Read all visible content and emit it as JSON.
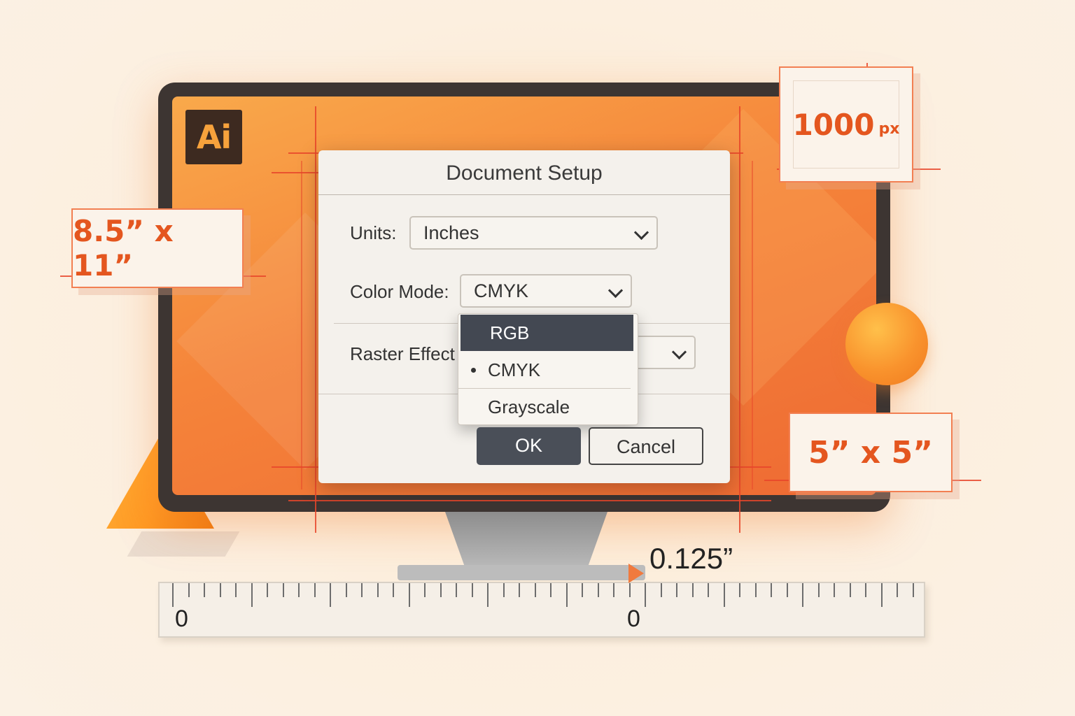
{
  "app": {
    "logo_text": "Ai"
  },
  "dialog": {
    "title": "Document Setup",
    "units_label": "Units:",
    "units_value": "Inches",
    "color_mode_label": "Color Mode:",
    "color_mode_value": "CMYK",
    "raster_label": "Raster Effect",
    "color_mode_options": [
      {
        "label": "RGB",
        "highlighted": true,
        "checked": false
      },
      {
        "label": "CMYK",
        "highlighted": false,
        "checked": true
      },
      {
        "label": "Grayscale",
        "highlighted": false,
        "checked": false
      }
    ],
    "ok_label": "OK",
    "cancel_label": "Cancel"
  },
  "callouts": {
    "paper_size": "8.5” x 11”",
    "pixel_value": "1000",
    "pixel_unit": "px",
    "square_size": "5” x 5”"
  },
  "ruler": {
    "left_zero": "0",
    "center_zero": "0",
    "measurement": "0.125”"
  },
  "colors": {
    "accent": "#f27f52",
    "dialog_bg": "#f4f1ec",
    "highlight": "#434852"
  },
  "icons": [
    "chevron-down-icon",
    "bullet-icon",
    "ruler-marker-icon"
  ]
}
